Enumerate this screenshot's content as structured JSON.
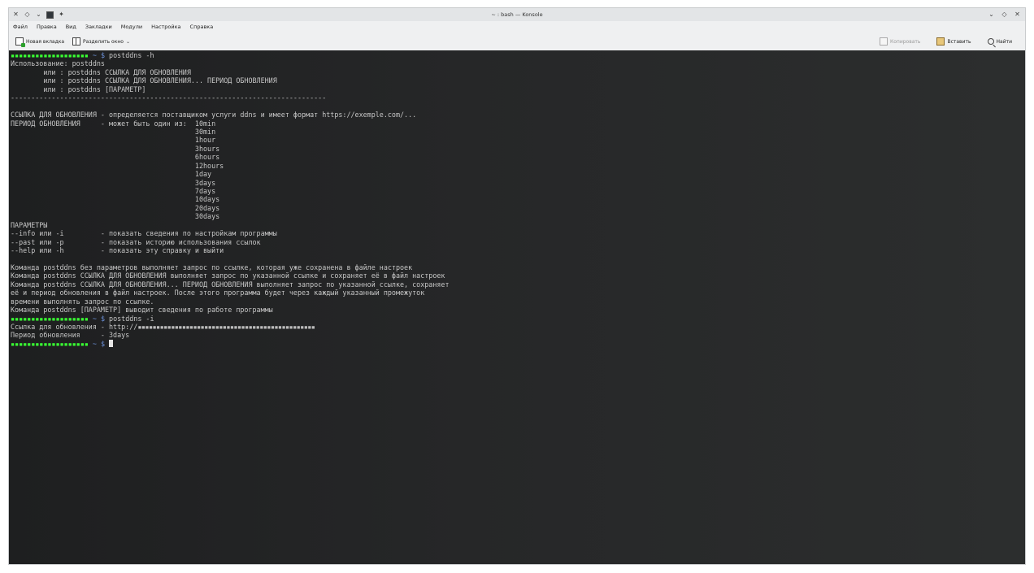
{
  "window": {
    "title": "~ : bash — Konsole",
    "menu": [
      "Файл",
      "Правка",
      "Вид",
      "Закладки",
      "Модули",
      "Настройка",
      "Справка"
    ],
    "toolbar": {
      "new_tab": "Новая вкладка",
      "split": "Разделить окно",
      "copy": "Копировать",
      "paste": "Вставить",
      "find": "Найти"
    }
  },
  "icons": {
    "close": "close-icon",
    "pin": "pin-icon",
    "app": "konsole-icon",
    "new_tab": "new-tab-icon",
    "split": "split-view-icon",
    "copy": "copy-icon",
    "paste": "paste-icon",
    "find": "search-icon"
  },
  "colors": {
    "prompt": "#39ff33",
    "path": "#6b8fd6",
    "text": "#c6c6c6",
    "background": "#262728"
  },
  "terminal": {
    "prompt_user": "▪▪▪▪▪▪▪▪▪▪▪▪▪▪▪▪▪▪▪",
    "prompt_path": " ~ $ ",
    "cmd1": "postddns -h",
    "help": [
      "Использование: postddns",
      "        или : postddns ССЫЛКА ДЛЯ ОБНОВЛЕНИЯ",
      "        или : postddns ССЫЛКА ДЛЯ ОБНОВЛЕНИЯ... ПЕРИОД ОБНОВЛЕНИЯ",
      "        или : postddns [ПАРАМЕТР]",
      "-----------------------------------------------------------------------------",
      "",
      "ССЫЛКА ДЛЯ ОБНОВЛЕНИЯ - определяется поставщиком услуги ddns и имеет формат https://exemple.com/...",
      "ПЕРИОД ОБНОВЛЕНИЯ     - может быть один из:  10min",
      "                                             30min",
      "                                             1hour",
      "                                             3hours",
      "                                             6hours",
      "                                             12hours",
      "                                             1day",
      "                                             3days",
      "                                             7days",
      "                                             10days",
      "                                             20days",
      "                                             30days",
      "ПАРАМЕТРЫ",
      "--info или -i         - показать сведения по настройкам программы",
      "--past или -p         - показать историю использования ссылок",
      "--help или -h         - показать эту справку и выйти",
      "",
      "Команда postddns без параметров выполняет запрос по ссылке, которая уже сохранена в файле настроек",
      "Команда postddns ССЫЛКА ДЛЯ ОБНОВЛЕНИЯ выполняет запрос по указанной ссылке и сохраняет её в файл настроек",
      "Команда postddns ССЫЛКА ДЛЯ ОБНОВЛЕНИЯ... ПЕРИОД ОБНОВЛЕНИЯ выполняет запрос по указанной ссылке, сохраняет",
      "её и период обновления в файл настроек. После этого программа будет через каждый указанный промежуток",
      "времени выполнять запрос по ссылке.",
      "Команда postddns [ПАРАМЕТР] выводит сведения по работе программы"
    ],
    "cmd2": "postddns -i",
    "info_link_label": "Ссылка для обновления - http://",
    "info_link_masked": "▪▪▪▪▪▪▪▪▪▪▪▪▪▪▪▪▪▪▪▪▪▪▪▪▪▪▪▪▪▪▪▪▪▪▪▪▪▪▪▪▪▪▪▪▪▪▪▪",
    "info_period": "Период обновления     - 3days"
  }
}
